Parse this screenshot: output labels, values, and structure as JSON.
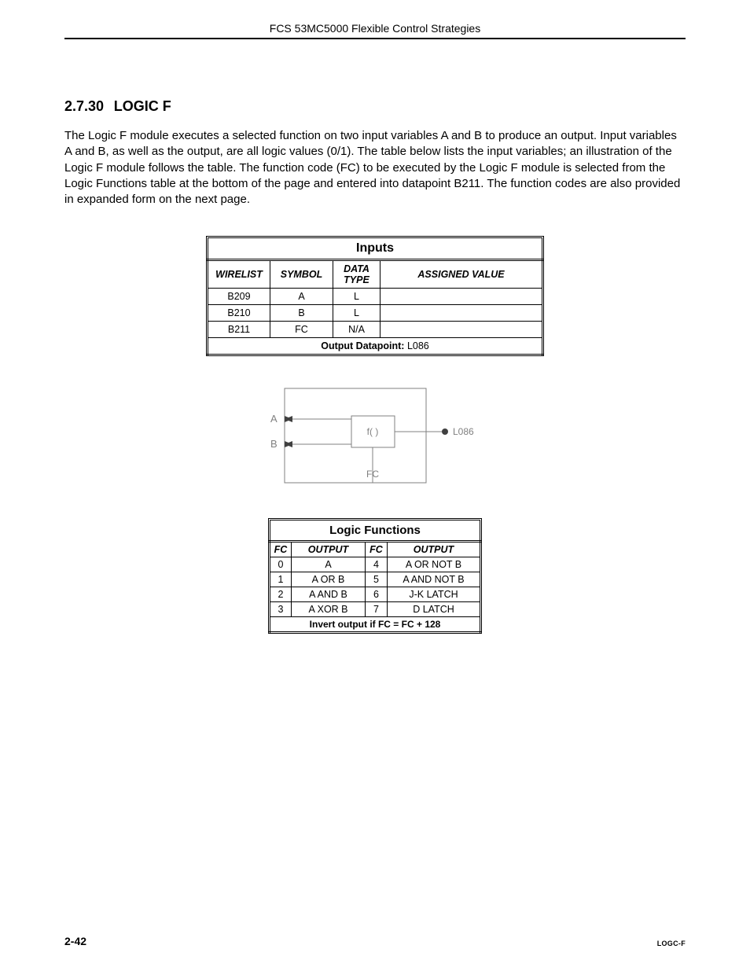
{
  "header": {
    "running": "FCS 53MC5000 Flexible Control Strategies"
  },
  "section": {
    "number": "2.7.30",
    "title": "LOGIC F"
  },
  "paragraph": "The Logic F module executes a selected function on two input variables A and B to produce an output.  Input variables A and B, as well as the output, are all logic values (0/1).  The table below lists the input variables; an illustration of the Logic F module follows the table.  The function code (FC) to be executed by the Logic F module is selected from the Logic Functions table at the bottom of the page and entered into datapoint B211.  The function codes are also provided in expanded form on the next page.",
  "inputs_table": {
    "title": "Inputs",
    "headers": {
      "wirelist": "WIRELIST",
      "symbol": "SYMBOL",
      "datatype": "DATA TYPE",
      "assigned": "ASSIGNED VALUE"
    },
    "rows": [
      {
        "wirelist": "B209",
        "symbol": "A",
        "datatype": "L",
        "assigned": ""
      },
      {
        "wirelist": "B210",
        "symbol": "B",
        "datatype": "L",
        "assigned": ""
      },
      {
        "wirelist": "B211",
        "symbol": "FC",
        "datatype": "N/A",
        "assigned": ""
      }
    ],
    "output_label": "Output Datapoint:",
    "output_value": "L086"
  },
  "diagram": {
    "inA": "A",
    "inB": "B",
    "func": "f( )",
    "fc": "FC",
    "out": "L086"
  },
  "logic_functions": {
    "title": "Logic Functions",
    "headers": {
      "fc": "FC",
      "output": "OUTPUT"
    },
    "rows": [
      {
        "fc1": "0",
        "out1": "A",
        "fc2": "4",
        "out2": "A OR NOT B"
      },
      {
        "fc1": "1",
        "out1": "A OR B",
        "fc2": "5",
        "out2": "A AND NOT B"
      },
      {
        "fc1": "2",
        "out1": "A AND B",
        "fc2": "6",
        "out2": "J-K LATCH"
      },
      {
        "fc1": "3",
        "out1": "A XOR B",
        "fc2": "7",
        "out2": "D LATCH"
      }
    ],
    "note": "Invert output if FC = FC + 128"
  },
  "footer": {
    "pageno": "2-42",
    "code": "LOGC-F"
  }
}
